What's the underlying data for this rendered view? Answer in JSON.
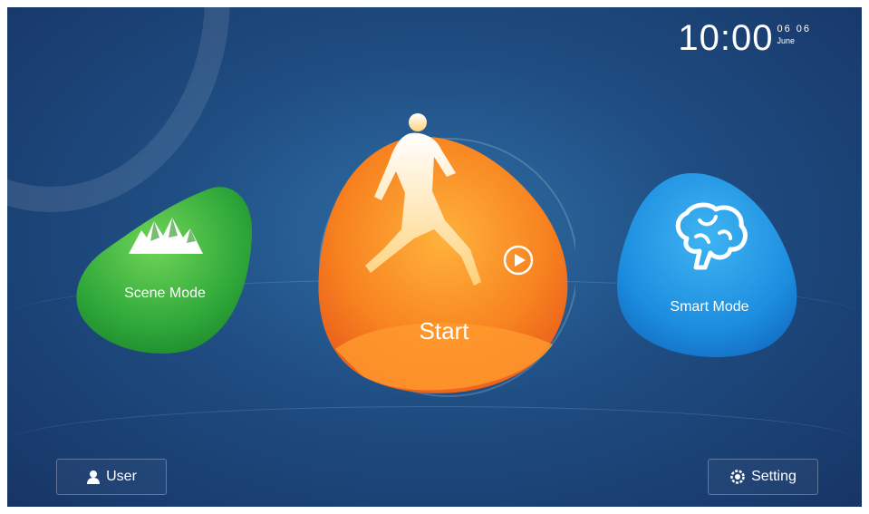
{
  "clock": {
    "time": "10:00",
    "date": "06 06",
    "month": "June"
  },
  "modes": {
    "scene": {
      "label": "Scene Mode",
      "icon": "mountain-icon",
      "color": "#35b53c"
    },
    "start": {
      "label": "Start",
      "icon": "runner-icon",
      "color": "#f27b22"
    },
    "smart": {
      "label": "Smart Mode",
      "icon": "brain-icon",
      "color": "#1e8fde"
    }
  },
  "footer": {
    "user_label": "User",
    "setting_label": "Setting"
  }
}
